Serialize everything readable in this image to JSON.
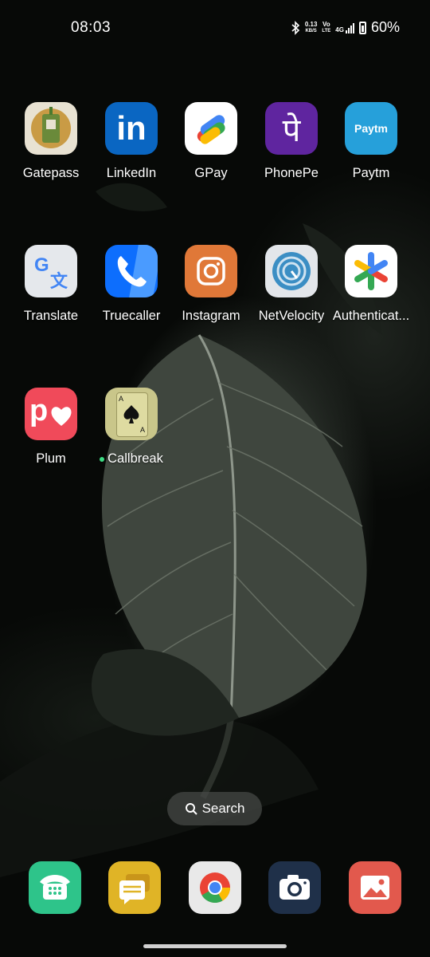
{
  "status_bar": {
    "time": "08:03",
    "net_speed_value": "0.13",
    "net_speed_unit": "KB/S",
    "volte_top": "Vo",
    "volte_bottom": "LTE",
    "network": "4G",
    "battery": "60%",
    "icons": [
      "bluetooth-icon",
      "signal-icon",
      "battery-icon"
    ]
  },
  "apps": [
    {
      "label": "Gatepass",
      "icon": "id-badge-icon"
    },
    {
      "label": "LinkedIn",
      "icon": "linkedin-icon",
      "glyph": "in"
    },
    {
      "label": "GPay",
      "icon": "gpay-icon"
    },
    {
      "label": "PhonePe",
      "icon": "phonepe-icon",
      "glyph": "पे"
    },
    {
      "label": "Paytm",
      "icon": "paytm-icon",
      "glyph": "Paytm"
    },
    {
      "label": "Translate",
      "icon": "translate-icon",
      "glyph_g": "G",
      "glyph_x": "文"
    },
    {
      "label": "Truecaller",
      "icon": "phone-handset-icon"
    },
    {
      "label": "Instagram",
      "icon": "instagram-icon"
    },
    {
      "label": "NetVelocity",
      "icon": "speedometer-icon"
    },
    {
      "label": "Authenticat...",
      "icon": "authenticator-icon"
    },
    {
      "label": "Plum",
      "icon": "plum-icon",
      "glyph": "p"
    },
    {
      "label": "Callbreak",
      "icon": "spade-card-icon",
      "new_badge": true
    }
  ],
  "search": {
    "label": "Search",
    "icon": "search-icon"
  },
  "dock": [
    {
      "name": "phone",
      "icon": "phone-icon",
      "color": "#2ec48a"
    },
    {
      "name": "messages",
      "icon": "messages-icon",
      "color": "#e0b426"
    },
    {
      "name": "chrome",
      "icon": "chrome-icon",
      "color": "#e9e9e9"
    },
    {
      "name": "camera",
      "icon": "camera-icon",
      "color": "#1f3049"
    },
    {
      "name": "gallery",
      "icon": "gallery-icon",
      "color": "#e2594d"
    }
  ]
}
